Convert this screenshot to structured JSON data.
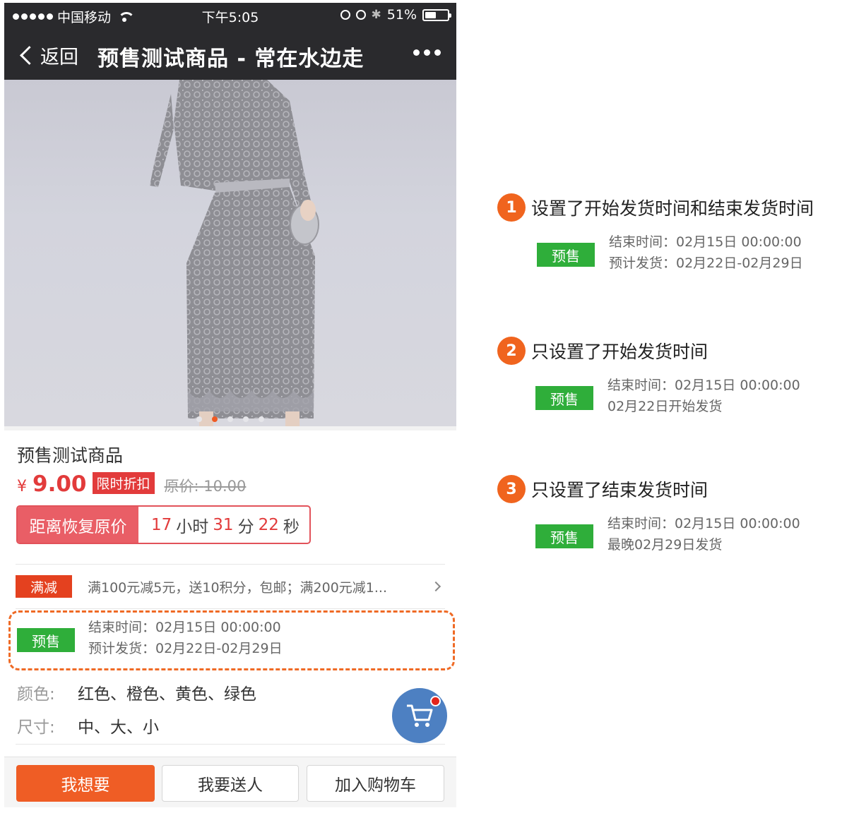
{
  "status_bar": {
    "carrier": "中国移动",
    "time": "下午5:05",
    "battery": "51%",
    "battery_level": 0.51
  },
  "nav": {
    "back_label": "返回",
    "title": "预售测试商品 - 常在水边走"
  },
  "gallery": {
    "dot_count": 5,
    "active_dot": 1
  },
  "product": {
    "title": "预售测试商品",
    "currency": "¥",
    "price": "9.00",
    "discount_tag": "限时折扣",
    "original_label": "原价:",
    "original_price": "10.00",
    "countdown": {
      "label": "距离恢复原价",
      "hours": "17",
      "hours_unit": "小时",
      "minutes": "31",
      "minutes_unit": "分",
      "seconds": "22",
      "seconds_unit": "秒"
    },
    "promo": {
      "tag": "满减",
      "text": "满100元减5元，送10积分，包邮；满200元减1..."
    },
    "presale": {
      "tag": "预售",
      "line1": "结束时间：02月15日 00:00:00",
      "line2": "预计发货：02月22日-02月29日"
    },
    "specs": [
      {
        "key": "颜色:",
        "value": "红色、橙色、黄色、绿色"
      },
      {
        "key": "尺寸:",
        "value": "中、大、小"
      }
    ]
  },
  "buttons": {
    "want": "我想要",
    "gift": "我要送人",
    "add_cart": "加入购物车"
  },
  "annotations": [
    {
      "number": "1",
      "title": "设置了开始发货时间和结束发货时间",
      "tag": "预售",
      "line1": "结束时间：02月15日 00:00:00",
      "line2": "预计发货：02月22日-02月29日"
    },
    {
      "number": "2",
      "title": "只设置了开始发货时间",
      "tag": "预售",
      "line1": "结束时间：02月15日 00:00:00",
      "line2": "02月22日开始发货"
    },
    {
      "number": "3",
      "title": "只设置了结束发货时间",
      "tag": "预售",
      "line1": "结束时间：02月15日 00:00:00",
      "line2": "最晚02月29日发货"
    }
  ],
  "colors": {
    "accent_orange": "#ef5d25",
    "price_red": "#e23b3b",
    "presale_green": "#2fae3a",
    "cart_blue": "#4d80c2",
    "topbar": "#2a2a2d"
  }
}
